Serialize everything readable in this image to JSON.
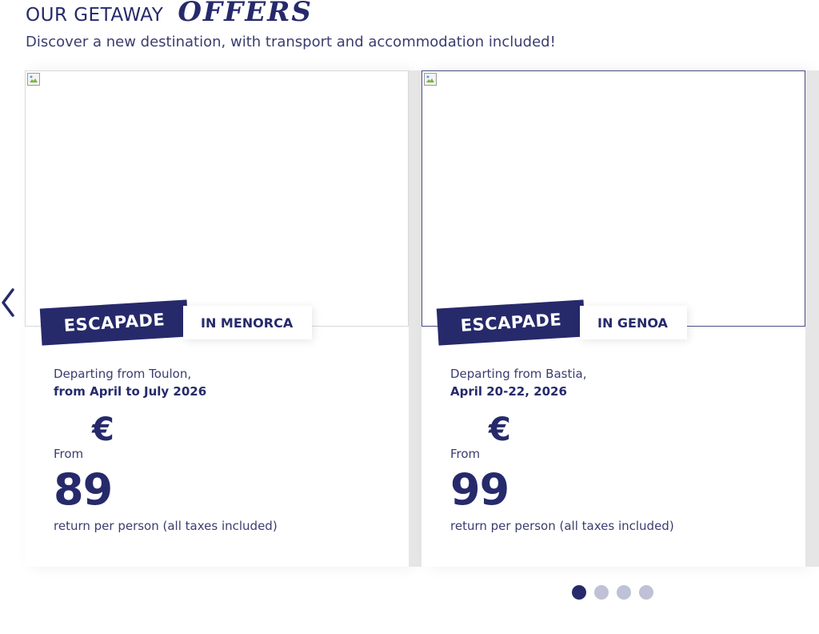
{
  "header": {
    "title": "OUR GETAWAY",
    "title_accent": "OFFERS",
    "subtitle": "Discover a new destination, with transport and accommodation included!"
  },
  "carousel": {
    "prev_icon": "chevron-left-icon",
    "cards": [
      {
        "badge_label": "ESCAPADE",
        "destination": "IN MENORCA",
        "departing": "Departing from Toulon,",
        "dates": "from April to July 2026",
        "currency": "€",
        "from_label": "From",
        "price": "89",
        "price_note": "return per person (all taxes included)"
      },
      {
        "badge_label": "ESCAPADE",
        "destination": "IN GENOA",
        "departing": "Departing from Bastia,",
        "dates": "April 20-22, 2026",
        "currency": "€",
        "from_label": "From",
        "price": "99",
        "price_note": "return per person (all taxes included)"
      }
    ],
    "pagination": {
      "count": 4,
      "active_index": 0
    }
  },
  "colors": {
    "brand": "#262a6b",
    "dot_inactive": "#bfc1d6",
    "separator": "#e6e6e6"
  }
}
